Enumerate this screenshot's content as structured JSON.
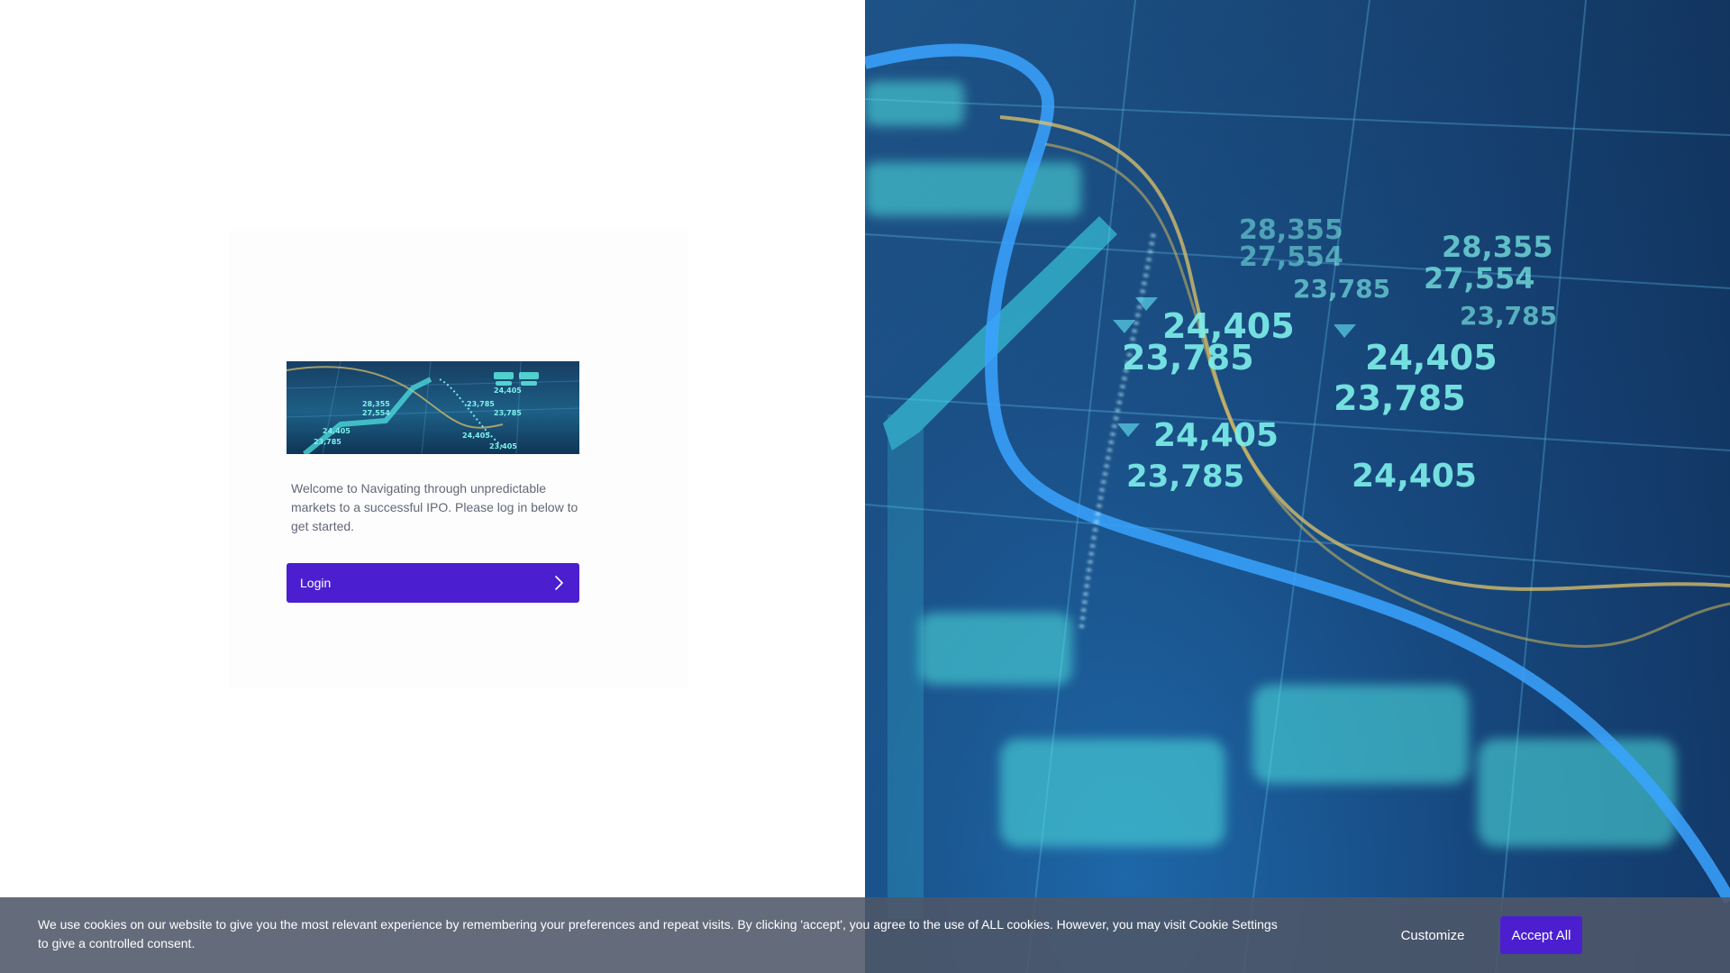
{
  "login_card": {
    "welcome_text": "Welcome to Navigating through unpredictable markets to a successful IPO. Please log in below to get started.",
    "login_label": "Login",
    "login_icon": "chevron-right-icon"
  },
  "hero": {
    "image_subject": "financial-ticker-data-visualization",
    "ticker_values": [
      "28,355",
      "27,554",
      "24,405",
      "23,785",
      "24,405",
      "23,785",
      "24,405",
      "23,785",
      "24,405",
      "23,785",
      "28,355",
      "27,554",
      "23,785"
    ]
  },
  "cookie_banner": {
    "text": "We use cookies on our website to give you the most relevant experience by remembering your preferences and repeat visits. By clicking 'accept', you agree to the use of ALL cookies. However, you may visit Cookie Settings to give a controlled consent.",
    "customize_label": "Customize",
    "accept_label": "Accept All"
  },
  "colors": {
    "primary": "#4b1fd0",
    "cookie_bar": "#4e5668",
    "text_muted": "#636779",
    "hero_blue": "#174a82",
    "hero_cyan": "#3ee6e0",
    "hero_gold": "#d8c36a"
  }
}
